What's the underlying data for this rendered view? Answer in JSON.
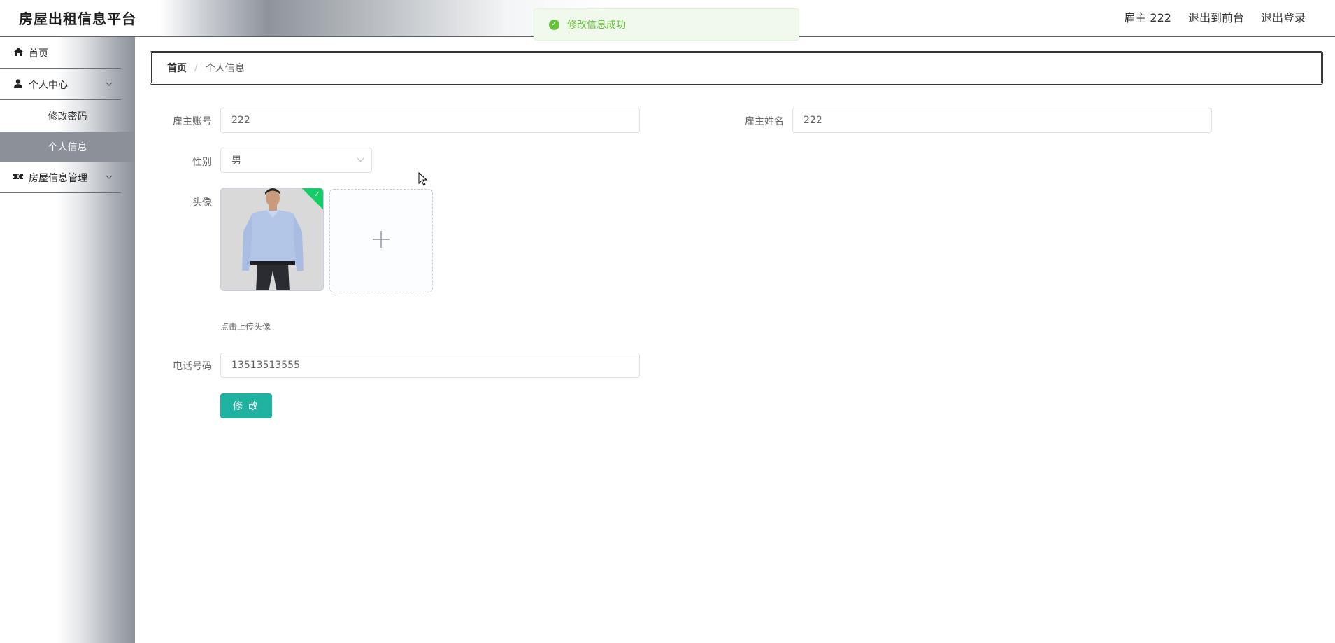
{
  "app": {
    "title": "房屋出租信息平台"
  },
  "header": {
    "user": "雇主 222",
    "front_link": "退出到前台",
    "logout_link": "退出登录"
  },
  "toast": {
    "message": "修改信息成功",
    "color": "#67c23a"
  },
  "sidebar": {
    "items": [
      {
        "label": "首页",
        "icon": "home-icon"
      },
      {
        "label": "个人中心",
        "icon": "user-icon"
      },
      {
        "label": "修改密码"
      },
      {
        "label": "个人信息",
        "active": true
      },
      {
        "label": "房屋信息管理",
        "icon": "ticket-icon"
      }
    ]
  },
  "breadcrumb": {
    "home": "首页",
    "separator": "/",
    "current": "个人信息"
  },
  "form": {
    "account_label": "雇主账号",
    "account_value": "222",
    "name_label": "雇主姓名",
    "name_value": "222",
    "gender_label": "性别",
    "gender_value": "男",
    "avatar_label": "头像",
    "avatar_tip": "点击上传头像",
    "phone_label": "电话号码",
    "phone_value": "13513513555",
    "submit_label": "修 改"
  },
  "colors": {
    "accent": "#20b2a0",
    "success": "#13ce66"
  }
}
